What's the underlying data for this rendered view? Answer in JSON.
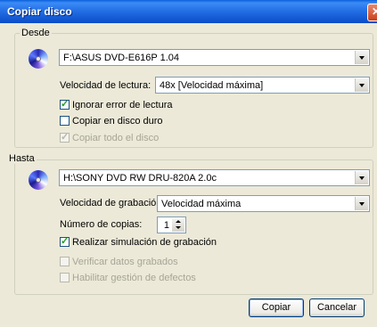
{
  "window": {
    "title": "Copiar disco",
    "close_symbol": "✕"
  },
  "desde": {
    "legend": "Desde",
    "drive": "F:\\ASUS DVD-E616P 1.04",
    "read_speed_label": "Velocidad de lectura:",
    "read_speed_value": "48x [Velocidad máxima]",
    "ignore_errors_label": "Ignorar error de lectura",
    "ignore_errors_checked": true,
    "copy_to_hd_label": "Copiar en disco duro",
    "copy_to_hd_checked": false,
    "copy_all_label": "Copiar todo el disco",
    "copy_all_checked": true
  },
  "hasta": {
    "legend": "Hasta",
    "drive": "H:\\SONY DVD RW DRU-820A 2.0c",
    "write_speed_label": "Velocidad de grabación:",
    "write_speed_value": "Velocidad máxima",
    "copies_label": "Número de copias:",
    "copies_value": "1",
    "simulate_label": "Realizar simulación de grabación",
    "simulate_checked": true,
    "verify_label": "Verificar datos grabados",
    "verify_checked": false,
    "defects_label": "Habilitar gestión de defectos",
    "defects_checked": false
  },
  "buttons": {
    "copy": "Copiar",
    "cancel": "Cancelar"
  },
  "colors": {
    "titlebar": "#0A5FD9",
    "dialog_bg": "#ECE9D8",
    "check_mark": "#21A121"
  }
}
